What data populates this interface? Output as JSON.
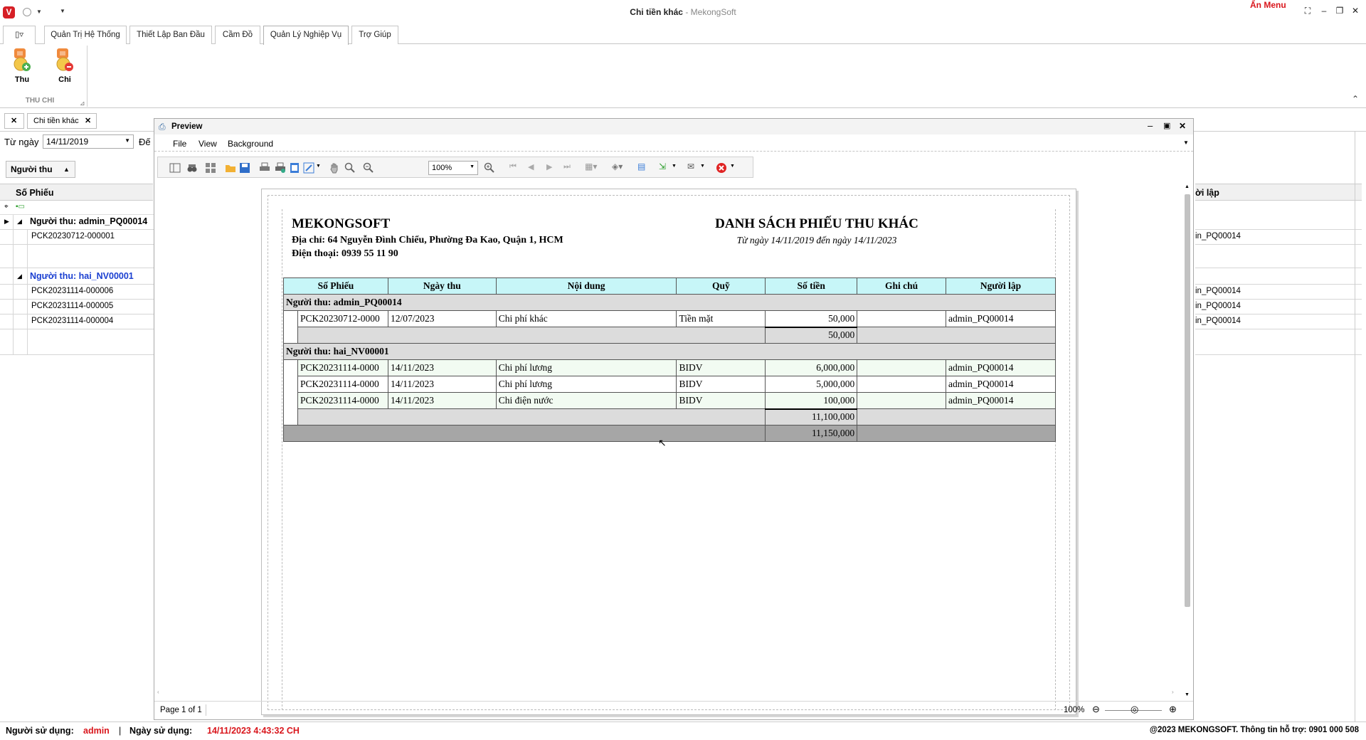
{
  "titlebar": {
    "title_main": "Chi tiền khác",
    "title_sep": " - ",
    "title_app": "MekongSoft",
    "logo_letter": "V",
    "an_menu": "Ẩn Menu"
  },
  "ribbon": {
    "tabs": [
      "Quản Trị Hệ Thống",
      "Thiết Lập Ban Đầu",
      "Cầm Đồ",
      "Quản Lý Nghiệp Vụ",
      "Trợ Giúp"
    ],
    "active_tab": "Quản Lý Nghiệp Vụ",
    "btn_thu": "Thu",
    "btn_chi": "Chi",
    "group_label": "THU CHI"
  },
  "doc_tabs": {
    "tab1": "Chi tiền khác"
  },
  "filter": {
    "from_label": "Từ ngày",
    "from_value": "14/11/2019",
    "to_label_partial": "Đế"
  },
  "group_panel": {
    "label": "Người thu"
  },
  "grid": {
    "col_so_phieu": "Số Phiếu",
    "col_nguoi_lap_partial": "ời lập",
    "group1": "Người thu: admin_PQ00014",
    "group2": "Người thu: hai_NV00001",
    "rows1": [
      "PCK20230712-000001"
    ],
    "rows2": [
      "PCK20231114-000006",
      "PCK20231114-000005",
      "PCK20231114-000004"
    ],
    "nguoi_lap_rows1": [
      "in_PQ00014"
    ],
    "nguoi_lap_rows2": [
      "in_PQ00014",
      "in_PQ00014",
      "in_PQ00014"
    ]
  },
  "preview": {
    "title": "Preview",
    "menu": [
      "File",
      "View",
      "Background"
    ],
    "zoom": "100%",
    "page_info": "Page 1 of 1",
    "zoom_status": "100%"
  },
  "report": {
    "company": "MEKONGSOFT",
    "address": "Địa chỉ: 64 Nguyễn Đình Chiểu, Phường Đa Kao, Quận 1, HCM",
    "phone": "Điện thoại: 0939 55 11 90",
    "title": "DANH SÁCH PHIẾU THU KHÁC",
    "date_range": "Từ ngày 14/11/2019 đến ngày 14/11/2023",
    "headers": [
      "Số Phiếu",
      "Ngày thu",
      "Nội dung",
      "Quỹ",
      "Số tiền",
      "Ghi chú",
      "Người lập"
    ],
    "group1": {
      "label": "Người thu: admin_PQ00014",
      "rows": [
        [
          "PCK20230712-0000",
          "12/07/2023",
          "Chi phí khác",
          "Tiền mặt",
          "50,000",
          "",
          "admin_PQ00014"
        ]
      ],
      "subtotal": "50,000"
    },
    "group2": {
      "label": "Người thu: hai_NV00001",
      "rows": [
        [
          "PCK20231114-0000",
          "14/11/2023",
          "Chi phí lương",
          "BIDV",
          "6,000,000",
          "",
          "admin_PQ00014"
        ],
        [
          "PCK20231114-0000",
          "14/11/2023",
          "Chi phí lương",
          "BIDV",
          "5,000,000",
          "",
          "admin_PQ00014"
        ],
        [
          "PCK20231114-0000",
          "14/11/2023",
          "Chi điện nước",
          "BIDV",
          "100,000",
          "",
          "admin_PQ00014"
        ]
      ],
      "subtotal": "11,100,000"
    },
    "grand_total": "11,150,000"
  },
  "status": {
    "user_label": "Người sử dụng:",
    "user": "admin",
    "date_label": "Ngày sử dụng:",
    "date": "14/11/2023 4:43:32 CH",
    "copyright": "@2023 MEKONGSOFT. Thông tin hỗ trợ: 0901 000 508"
  }
}
